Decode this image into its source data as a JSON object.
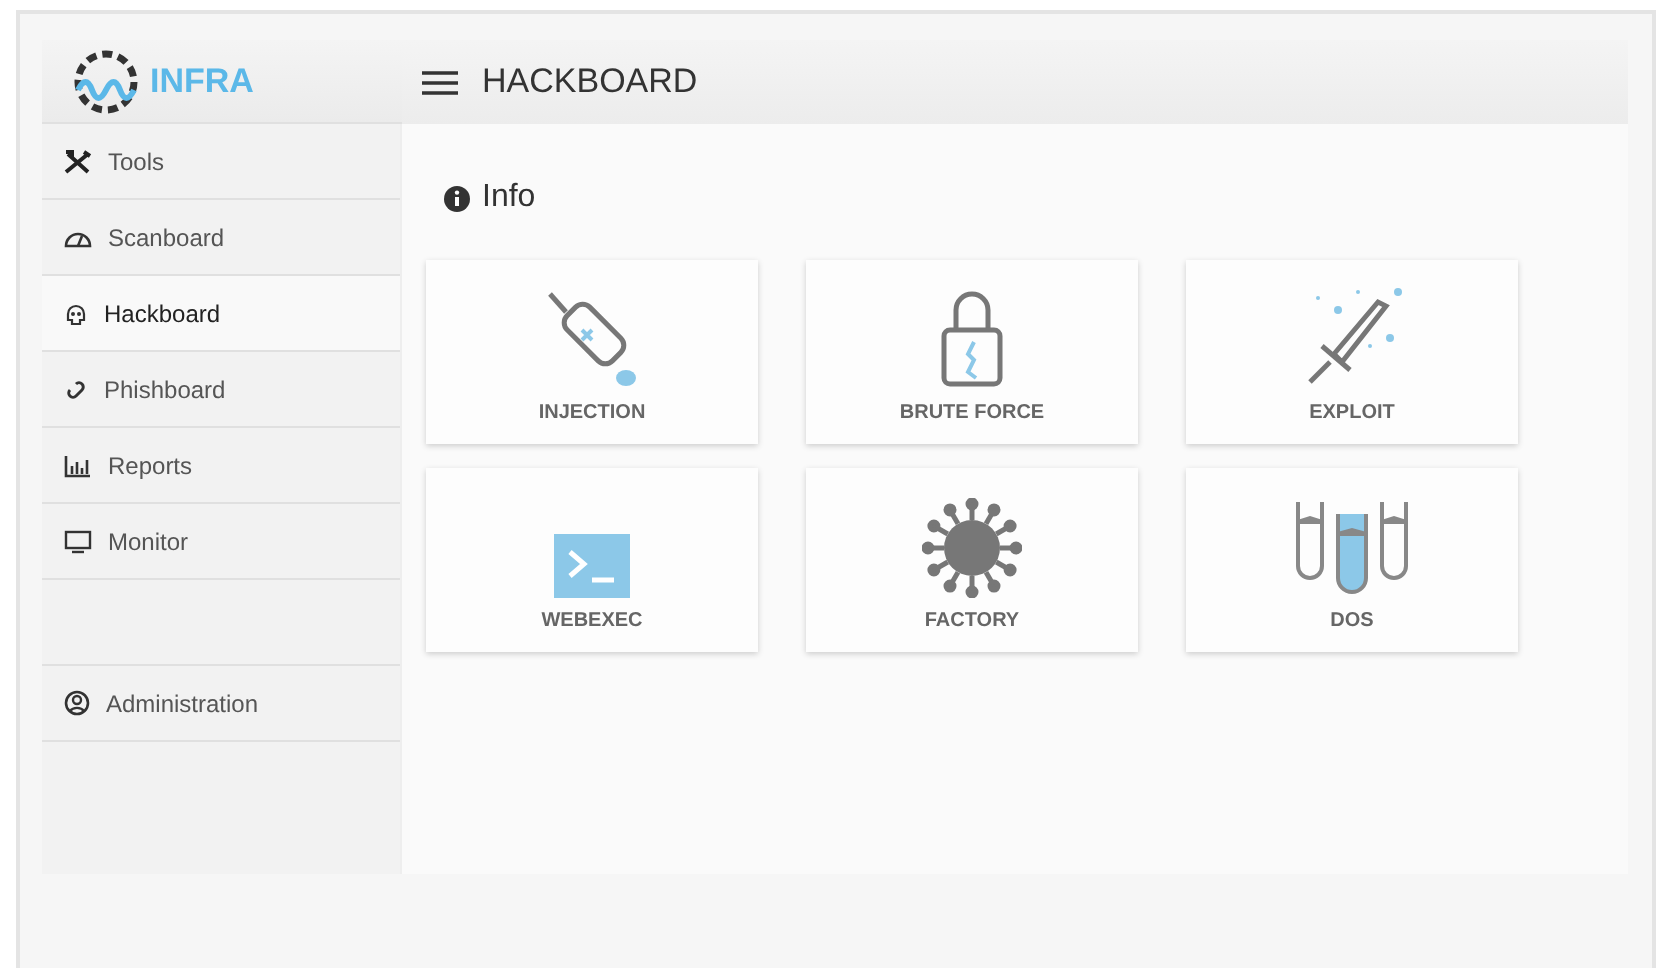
{
  "logo": {
    "text": "INFRA"
  },
  "header": {
    "title": "HACKBOARD"
  },
  "sidebar": {
    "items": [
      {
        "label": "Tools",
        "selected": false
      },
      {
        "label": "Scanboard",
        "selected": false
      },
      {
        "label": "Hackboard",
        "selected": true
      },
      {
        "label": "Phishboard",
        "selected": false
      },
      {
        "label": "Reports",
        "selected": false
      },
      {
        "label": "Monitor",
        "selected": false
      }
    ],
    "footer_items": [
      {
        "label": "Administration",
        "selected": false
      }
    ]
  },
  "section": {
    "title": "Info"
  },
  "cards": [
    {
      "label": "INJECTION"
    },
    {
      "label": "BRUTE FORCE"
    },
    {
      "label": "EXPLOIT"
    },
    {
      "label": "WEBEXEC"
    },
    {
      "label": "FACTORY"
    },
    {
      "label": "DOS"
    }
  ]
}
